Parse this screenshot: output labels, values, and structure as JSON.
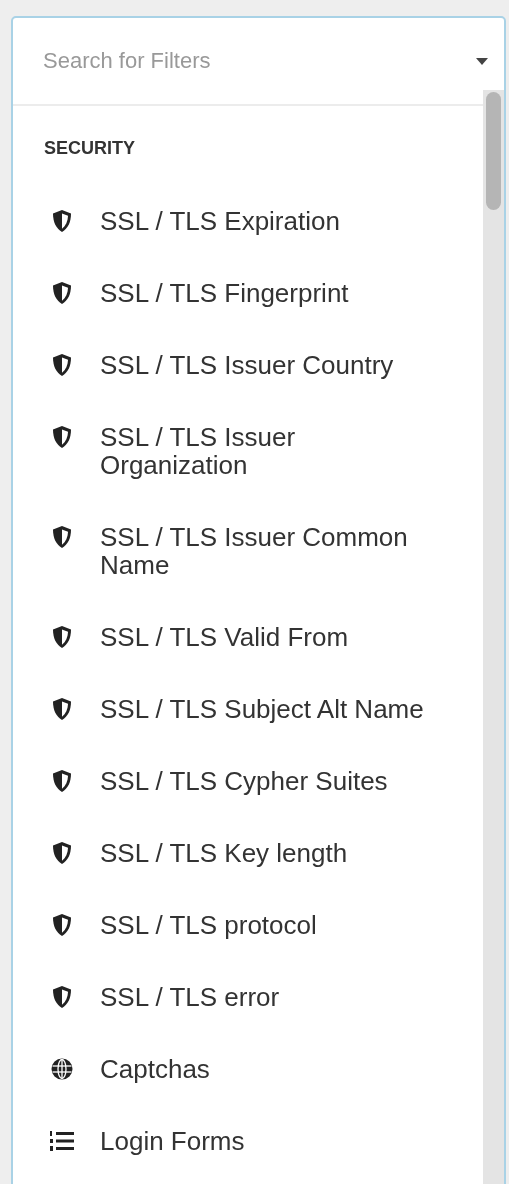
{
  "search": {
    "placeholder": "Search for Filters"
  },
  "section": {
    "title": "SECURITY"
  },
  "items": [
    {
      "label": "SSL / TLS Expiration",
      "kind": "shield"
    },
    {
      "label": "SSL / TLS Fingerprint",
      "kind": "shield"
    },
    {
      "label": "SSL / TLS Issuer Country",
      "kind": "shield"
    },
    {
      "label": "SSL / TLS Issuer Organization",
      "kind": "shield"
    },
    {
      "label": "SSL / TLS Issuer Common Name",
      "kind": "shield"
    },
    {
      "label": "SSL / TLS Valid From",
      "kind": "shield"
    },
    {
      "label": "SSL / TLS Subject Alt Name",
      "kind": "shield"
    },
    {
      "label": "SSL / TLS Cypher Suites",
      "kind": "shield"
    },
    {
      "label": "SSL / TLS Key length",
      "kind": "shield"
    },
    {
      "label": "SSL / TLS protocol",
      "kind": "shield"
    },
    {
      "label": "SSL / TLS error",
      "kind": "shield"
    },
    {
      "label": "Captchas",
      "kind": "globe"
    },
    {
      "label": "Login Forms",
      "kind": "list"
    }
  ]
}
